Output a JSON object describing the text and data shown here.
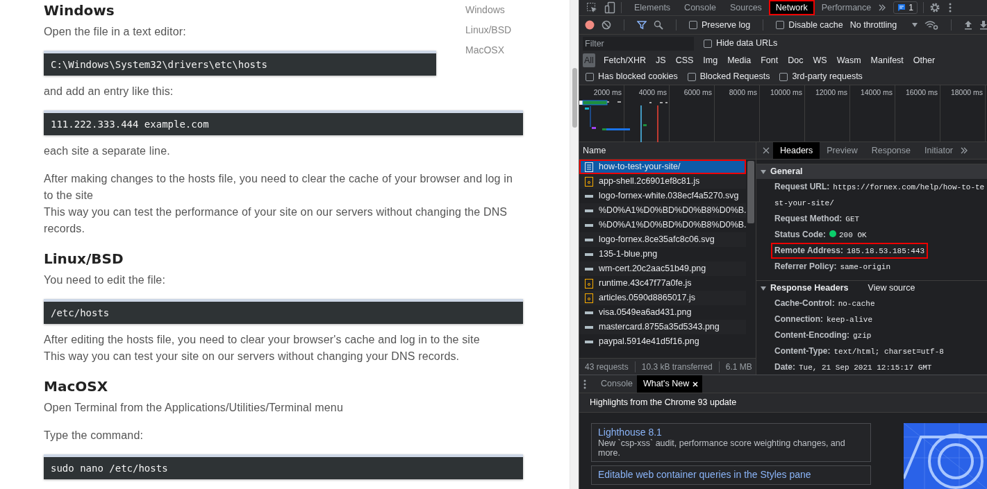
{
  "article": {
    "toc": [
      {
        "label": "Windows"
      },
      {
        "label": "Linux/BSD"
      },
      {
        "label": "MacOSX"
      }
    ],
    "blocks": [
      {
        "kind": "heading",
        "text": "Windows"
      },
      {
        "kind": "paragraph",
        "lines": [
          "Open the file in a text editor:"
        ]
      },
      {
        "kind": "code",
        "text": "C:\\Windows\\System32\\drivers\\etc\\hosts"
      },
      {
        "kind": "paragraph",
        "lines": [
          "and add an entry like this:"
        ]
      },
      {
        "kind": "code",
        "text": "111.222.333.444 example.com"
      },
      {
        "kind": "paragraph",
        "lines": [
          "each site a separate line."
        ]
      },
      {
        "kind": "paragraph",
        "lines": [
          "After making changes to the hosts file, you need to clear the cache of your browser and log in to the site",
          "This way you can test the performance of your site on our servers without changing the DNS records."
        ]
      },
      {
        "kind": "heading",
        "text": "Linux/BSD"
      },
      {
        "kind": "paragraph",
        "lines": [
          "You need to edit the file:"
        ]
      },
      {
        "kind": "code",
        "text": "/etc/hosts"
      },
      {
        "kind": "paragraph",
        "lines": [
          "After editing the hosts file, you need to clear your browser's cache and log in to the site",
          "This way you can test your site on our servers without changing your DNS records."
        ]
      },
      {
        "kind": "heading",
        "text": "MacOSX"
      },
      {
        "kind": "paragraph",
        "lines": [
          "Open Terminal from the Applications/Utilities/Terminal menu"
        ]
      },
      {
        "kind": "paragraph",
        "lines": [
          "Type the command:"
        ]
      },
      {
        "kind": "code",
        "text": "sudo nano /etc/hosts"
      }
    ]
  },
  "devtools": {
    "tabs": [
      {
        "label": "Elements",
        "selected": false,
        "highlighted": false
      },
      {
        "label": "Console",
        "selected": false,
        "highlighted": false
      },
      {
        "label": "Sources",
        "selected": false,
        "highlighted": false
      },
      {
        "label": "Network",
        "selected": true,
        "highlighted": true
      },
      {
        "label": "Performance",
        "selected": false,
        "highlighted": false
      }
    ],
    "issues_count": "1",
    "toolbar": {
      "recording": true,
      "preserve_log": {
        "label": "Preserve log",
        "checked": false
      },
      "disable_cache": {
        "label": "Disable cache",
        "checked": false
      },
      "throttling": "No throttling"
    },
    "filter": {
      "placeholder": "Filter"
    },
    "hide_data_urls": {
      "label": "Hide data URLs",
      "checked": false
    },
    "type_filters": [
      {
        "label": "All",
        "selected": true
      },
      {
        "label": "Fetch/XHR",
        "selected": false
      },
      {
        "label": "JS",
        "selected": false
      },
      {
        "label": "CSS",
        "selected": false
      },
      {
        "label": "Img",
        "selected": false
      },
      {
        "label": "Media",
        "selected": false
      },
      {
        "label": "Font",
        "selected": false
      },
      {
        "label": "Doc",
        "selected": false
      },
      {
        "label": "WS",
        "selected": false
      },
      {
        "label": "Wasm",
        "selected": false
      },
      {
        "label": "Manifest",
        "selected": false
      },
      {
        "label": "Other",
        "selected": false
      }
    ],
    "blocked_filters": [
      {
        "label": "Has blocked cookies",
        "checked": false
      },
      {
        "label": "Blocked Requests",
        "checked": false
      },
      {
        "label": "3rd-party requests",
        "checked": false
      }
    ],
    "timeline": {
      "ticks": [
        "2000 ms",
        "4000 ms",
        "6000 ms",
        "8000 ms",
        "10000 ms",
        "12000 ms",
        "14000 ms",
        "16000 ms",
        "18000 ms"
      ]
    },
    "requests": {
      "column": "Name",
      "rows": [
        {
          "name": "how-to-test-your-site/",
          "kind": "document",
          "selected": true,
          "highlighted": true
        },
        {
          "name": "app-shell.2c6901ef8c81.js",
          "kind": "script",
          "selected": false,
          "highlighted": false
        },
        {
          "name": "logo-fornex-white.038ecf4a5270.svg",
          "kind": "image",
          "selected": false,
          "highlighted": false
        },
        {
          "name": "%D0%A1%D0%BD%D0%B8%D0%B.",
          "kind": "image",
          "selected": false,
          "highlighted": false
        },
        {
          "name": "%D0%A1%D0%BD%D0%B8%D0%B.",
          "kind": "image",
          "selected": false,
          "highlighted": false
        },
        {
          "name": "logo-fornex.8ce35afc8c06.svg",
          "kind": "image",
          "selected": false,
          "highlighted": false
        },
        {
          "name": "135-1-blue.png",
          "kind": "image",
          "selected": false,
          "highlighted": false
        },
        {
          "name": "wm-cert.20c2aac51b49.png",
          "kind": "image",
          "selected": false,
          "highlighted": false
        },
        {
          "name": "runtime.43c47f77a0fe.js",
          "kind": "script",
          "selected": false,
          "highlighted": false
        },
        {
          "name": "articles.0590d8865017.js",
          "kind": "script",
          "selected": false,
          "highlighted": false
        },
        {
          "name": "visa.0549ea6ad431.png",
          "kind": "image",
          "selected": false,
          "highlighted": false
        },
        {
          "name": "mastercard.8755a35d5343.png",
          "kind": "image",
          "selected": false,
          "highlighted": false
        },
        {
          "name": "paypal.5914e41d5f16.png",
          "kind": "image",
          "selected": false,
          "highlighted": false
        }
      ]
    },
    "summary": [
      "43 requests",
      "10.3 kB transferred",
      "6.1 MB"
    ],
    "detail_tabs": [
      {
        "label": "Headers",
        "selected": true
      },
      {
        "label": "Preview",
        "selected": false
      },
      {
        "label": "Response",
        "selected": false
      },
      {
        "label": "Initiator",
        "selected": false
      }
    ],
    "sections": [
      {
        "title": "General",
        "expanded": true,
        "rows": [
          {
            "key": "Request URL:",
            "value": "https://fornex.com/help/how-to-test-your-site/",
            "kind": "plain",
            "highlighted": false
          },
          {
            "key": "Request Method:",
            "value": "GET",
            "kind": "plain",
            "highlighted": false
          },
          {
            "key": "Status Code:",
            "value": "200 OK",
            "kind": "status",
            "highlighted": false
          },
          {
            "key": "Remote Address:",
            "value": "185.18.53.185:443",
            "kind": "plain",
            "highlighted": true
          },
          {
            "key": "Referrer Policy:",
            "value": "same-origin",
            "kind": "plain",
            "highlighted": false
          }
        ]
      },
      {
        "title": "Response Headers",
        "link": "View source",
        "expanded": true,
        "rows": [
          {
            "key": "Cache-Control:",
            "value": "no-cache",
            "kind": "plain",
            "highlighted": false
          },
          {
            "key": "Connection:",
            "value": "keep-alive",
            "kind": "plain",
            "highlighted": false
          },
          {
            "key": "Content-Encoding:",
            "value": "gzip",
            "kind": "plain",
            "highlighted": false
          },
          {
            "key": "Content-Type:",
            "value": "text/html; charset=utf-8",
            "kind": "plain",
            "highlighted": false
          },
          {
            "key": "Date:",
            "value": "Tue, 21 Sep 2021 12:15:17 GMT",
            "kind": "plain",
            "highlighted": false
          }
        ]
      }
    ]
  },
  "drawer": {
    "tabs": [
      {
        "label": "Console",
        "selected": false,
        "closable": false
      },
      {
        "label": "What's New",
        "selected": true,
        "closable": true
      }
    ],
    "heading": "Highlights from the Chrome 93 update",
    "cards": [
      {
        "title": "Lighthouse 8.1",
        "description": "New `csp-xss` audit, performance score weighting changes, and more."
      },
      {
        "title": "Editable web container queries in the Styles pane"
      }
    ]
  }
}
